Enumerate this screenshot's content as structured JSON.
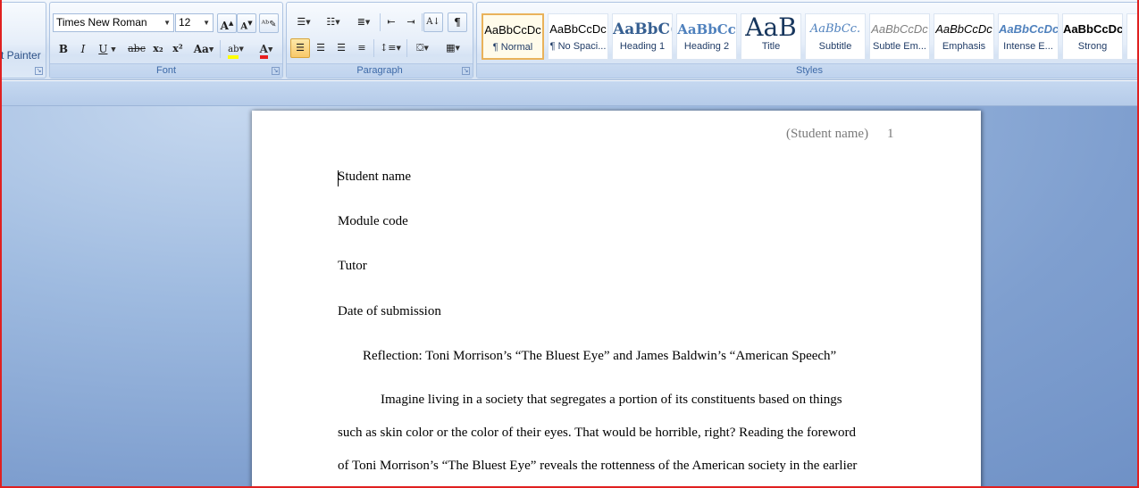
{
  "ribbon": {
    "clipboard": {
      "format_painter_label": "t Painter"
    },
    "font": {
      "label": "Font",
      "font_name": "Times New Roman",
      "font_size": "12",
      "grow": "A",
      "shrink": "A",
      "bold": "B",
      "italic": "I",
      "underline": "U",
      "strike": "abc",
      "subscript": "x₂",
      "superscript": "x²",
      "change_case": "Aa",
      "highlight": "ab",
      "font_color": "A"
    },
    "paragraph": {
      "label": "Paragraph",
      "show_marks": "¶"
    },
    "styles": {
      "label": "Styles",
      "items": [
        {
          "sample": "AaBbCcDc",
          "name": "¶ Normal"
        },
        {
          "sample": "AaBbCcDc",
          "name": "¶ No Spaci..."
        },
        {
          "sample": "AaBbC(",
          "name": "Heading 1"
        },
        {
          "sample": "AaBbCc",
          "name": "Heading 2"
        },
        {
          "sample": "AaB",
          "name": "Title"
        },
        {
          "sample": "AaBbCc.",
          "name": "Subtitle"
        },
        {
          "sample": "AaBbCcDc",
          "name": "Subtle Em..."
        },
        {
          "sample": "AaBbCcDc",
          "name": "Emphasis"
        },
        {
          "sample": "AaBbCcDc",
          "name": "Intense E..."
        },
        {
          "sample": "AaBbCcDc",
          "name": "Strong"
        }
      ]
    }
  },
  "document": {
    "header_name": "(Student name)",
    "header_page": "1",
    "lines": {
      "student_name": "Student name",
      "module_code": "Module code",
      "tutor": "Tutor",
      "date": "Date of submission",
      "title": "Reflection: Toni Morrison’s  “The Bluest Eye” and James Baldwin’s “American Speech”",
      "para1": "Imagine living  in  a society that segregates a portion  of its constituents based on things",
      "para2": "such as skin color or the color of their eyes. That would be horrible, right? Reading the foreword",
      "para3": "of Toni  Morrison’s  “The Bluest Eye” reveals the rottenness of the American society in the earlier"
    }
  },
  "colors": {
    "accent": "#3e6aa8",
    "highlight_yellow": "#ffff00",
    "font_red": "#e81e1e",
    "frame_red": "#e02020"
  }
}
